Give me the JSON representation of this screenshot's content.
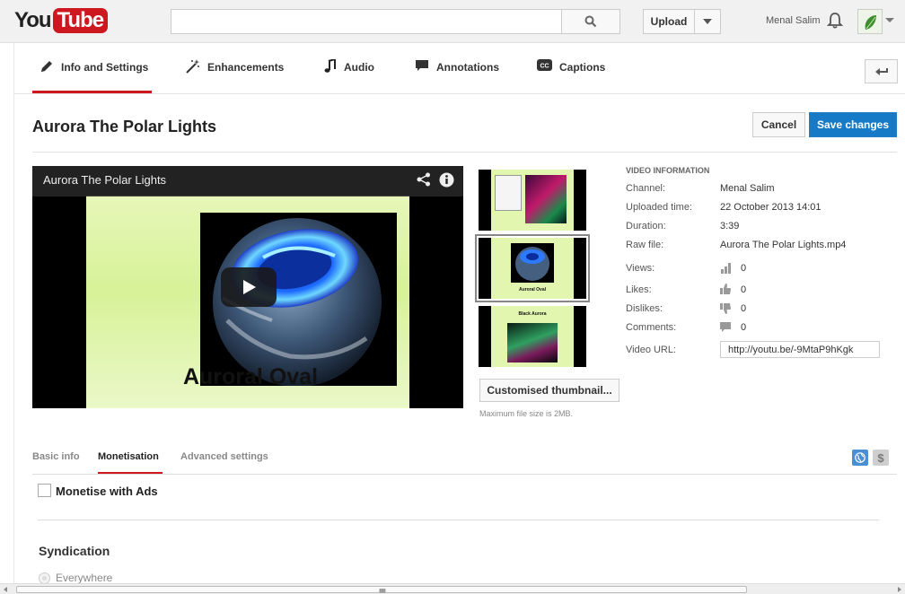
{
  "masthead": {
    "logo_you": "You",
    "logo_tube": "Tube",
    "search_placeholder": "",
    "upload_label": "Upload",
    "username": "Menal Salim",
    "icons": [
      "search-icon",
      "chevron-down-icon",
      "bell-icon",
      "avatar"
    ]
  },
  "editor_tabs": [
    {
      "label": "Info and Settings",
      "icon": "pencil-icon",
      "active": true
    },
    {
      "label": "Enhancements",
      "icon": "magic-wand-icon",
      "active": false
    },
    {
      "label": "Audio",
      "icon": "music-note-icon",
      "active": false
    },
    {
      "label": "Annotations",
      "icon": "speech-bubble-icon",
      "active": false
    },
    {
      "label": "Captions",
      "icon": "cc-icon",
      "active": false
    }
  ],
  "title_row": {
    "title": "Aurora The Polar Lights",
    "cancel_label": "Cancel",
    "save_label": "Save changes"
  },
  "player": {
    "overlay_title": "Aurora The Polar Lights",
    "frame_caption": "Auroral Oval"
  },
  "thumbnails": [
    {
      "label": "",
      "selected": false
    },
    {
      "label": "Auroral Oval",
      "selected": true
    },
    {
      "label": "Black Aurora",
      "selected": false
    }
  ],
  "custom_thumbnail_label": "Customised thumbnail...",
  "max_file_size": "Maximum file size is 2MB.",
  "video_info": {
    "heading": "VIDEO INFORMATION",
    "channel_label": "Channel:",
    "channel": "Menal Salim",
    "uploaded_label": "Uploaded time:",
    "uploaded": "22 October 2013 14:01",
    "duration_label": "Duration:",
    "duration": "3:39",
    "raw_file_label": "Raw file:",
    "raw_file": "Aurora The Polar Lights.mp4",
    "views_label": "Views:",
    "views": "0",
    "likes_label": "Likes:",
    "likes": "0",
    "dislikes_label": "Dislikes:",
    "dislikes": "0",
    "comments_label": "Comments:",
    "comments": "0",
    "url_label": "Video URL:",
    "url": "http://youtu.be/-9MtaP9hKgk"
  },
  "section_tabs": [
    {
      "label": "Basic info",
      "active": false
    },
    {
      "label": "Monetisation",
      "active": true
    },
    {
      "label": "Advanced settings",
      "active": false
    }
  ],
  "monetisation": {
    "checkbox_label": "Monetise with Ads",
    "syndication_title": "Syndication",
    "syndication_option": "Everywhere"
  },
  "colors": {
    "brand_red": "#cc181e",
    "primary_blue": "#167ac6",
    "globe_blue": "#4a8fd6"
  }
}
